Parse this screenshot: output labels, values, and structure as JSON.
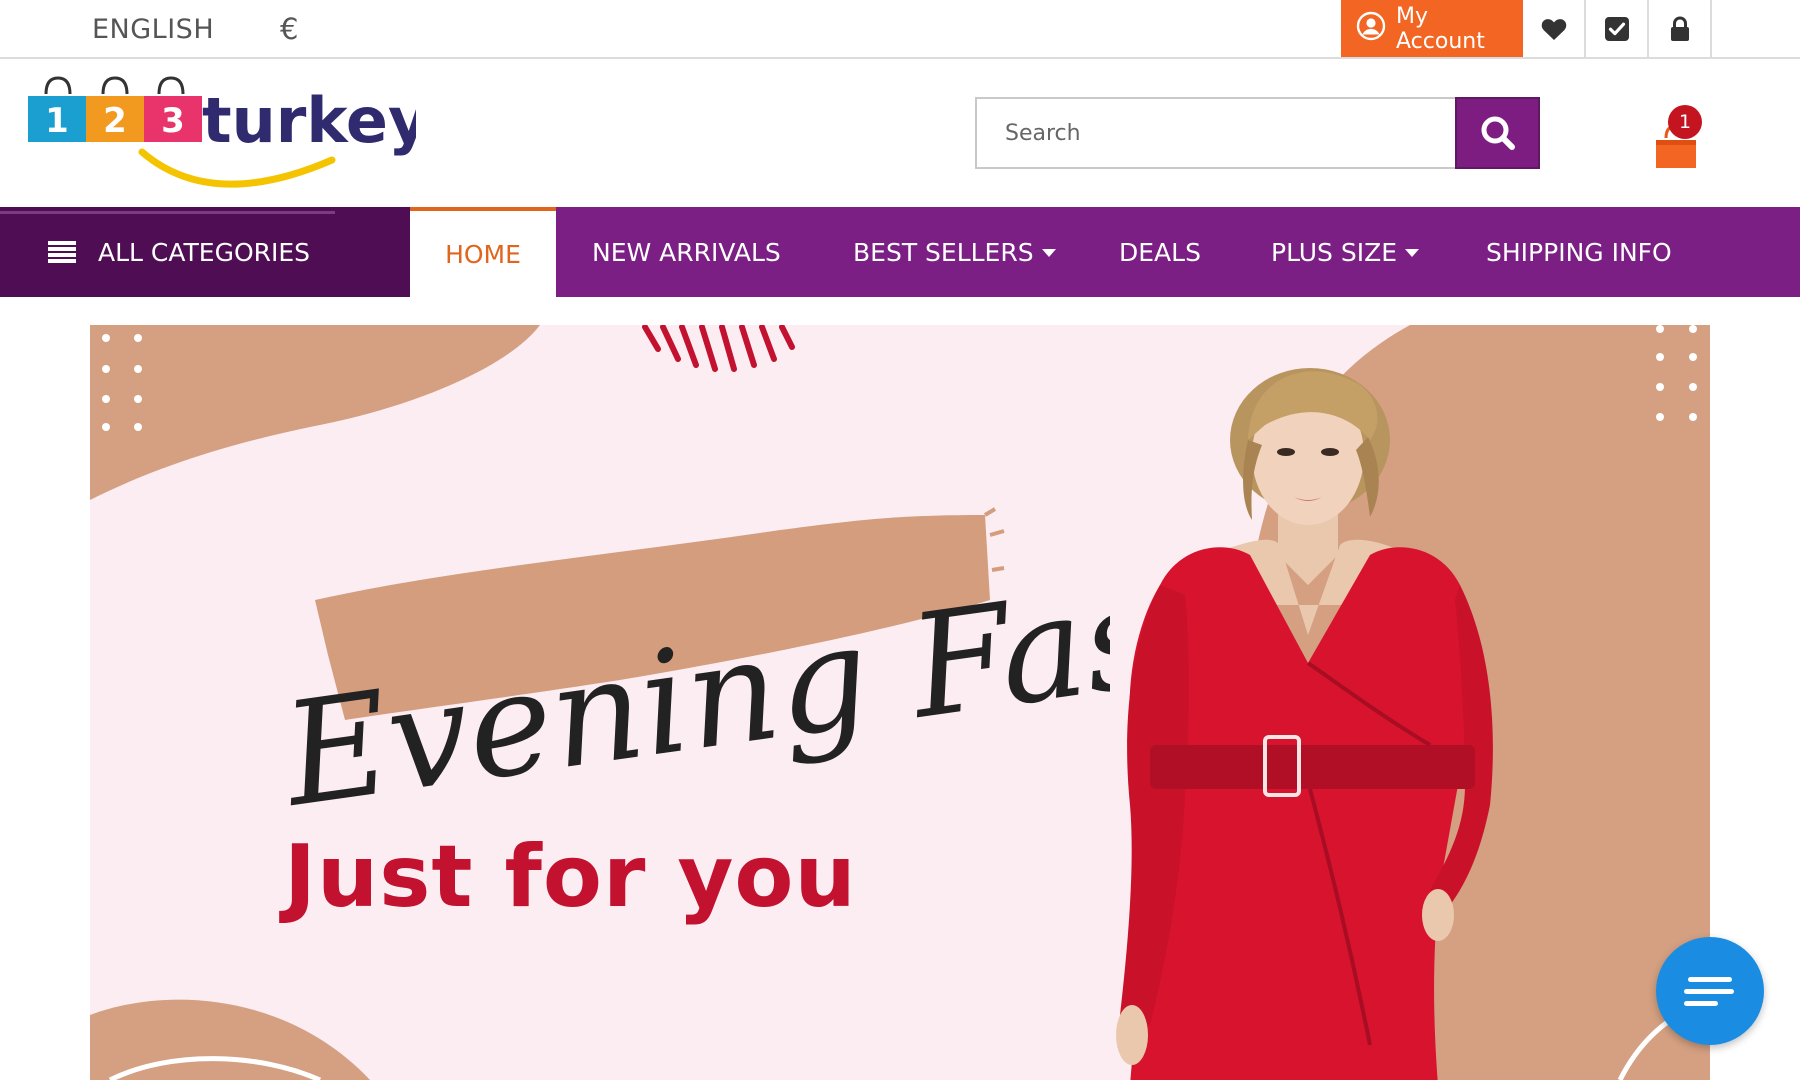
{
  "topbar": {
    "language": "ENGLISH",
    "currency": "€",
    "account_label": "My Account",
    "icons": [
      "account-icon",
      "heart-icon",
      "check-icon",
      "lock-icon"
    ]
  },
  "header": {
    "logo": {
      "digits": [
        "1",
        "2",
        "3"
      ],
      "brand": "turkey"
    },
    "search": {
      "placeholder": "Search",
      "button_icon": "search-icon"
    },
    "cart": {
      "icon": "cart-icon",
      "count": "1"
    }
  },
  "nav": {
    "all_categories": "ALL CATEGORIES",
    "items": [
      {
        "label": "HOME",
        "active": true
      },
      {
        "label": "NEW ARRIVALS"
      },
      {
        "label": "BEST SELLERS",
        "dropdown": true
      },
      {
        "label": "DEALS"
      },
      {
        "label": "PLUS SIZE",
        "dropdown": true
      },
      {
        "label": "SHIPPING INFO"
      }
    ]
  },
  "hero": {
    "script_title": "Evening Fashion",
    "tagline": "Just for you"
  },
  "chat": {
    "icon": "chat-icon"
  },
  "colors": {
    "accent_orange": "#f26522",
    "nav_purple": "#7b1f85",
    "nav_dark_purple": "#4f0e54",
    "hero_pink": "#fcedf3",
    "hero_tan": "#d4a081",
    "tagline_red": "#c3122f",
    "chat_blue": "#1a8de3"
  }
}
